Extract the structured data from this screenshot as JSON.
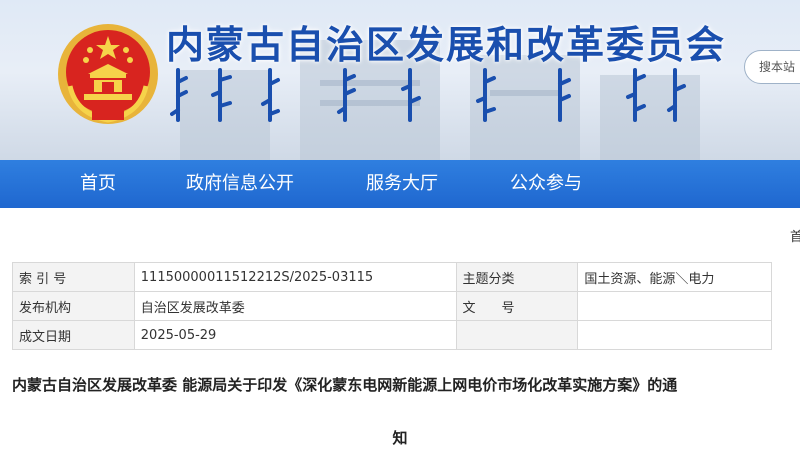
{
  "header": {
    "site_title": "内蒙古自治区发展和改革委员会",
    "search_placeholder": "搜本站"
  },
  "nav": {
    "items": [
      "首页",
      "政府信息公开",
      "服务大厅",
      "公众参与"
    ],
    "edge_char": "首"
  },
  "meta_table": {
    "rows": [
      {
        "label1": "索 引 号",
        "value1": "11150000011512212S/2025-03115",
        "label2": "主题分类",
        "value2": "国土资源、能源＼电力"
      },
      {
        "label1": "发布机构",
        "value1": "自治区发展改革委",
        "label2": "文　　号",
        "value2": ""
      },
      {
        "label1": "成文日期",
        "value1": "2025-05-29"
      }
    ]
  },
  "document": {
    "title_line1": "内蒙古自治区发展改革委 能源局关于印发《深化蒙东电网新能源上网电价市场化改革实施方案》的通",
    "title_line2": "知"
  }
}
